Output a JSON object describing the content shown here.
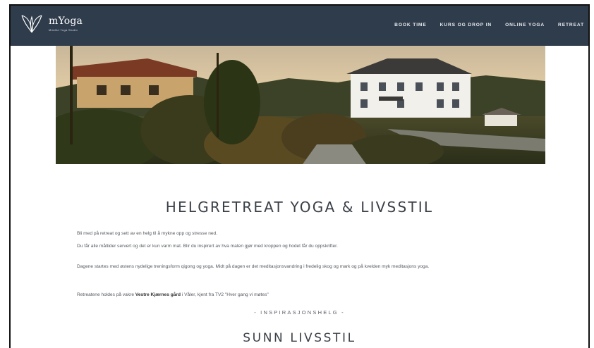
{
  "header": {
    "logo_name": "mYoga",
    "logo_tagline": "Mindful Yoga Studio",
    "nav": [
      {
        "label": "BOOK TIME"
      },
      {
        "label": "KURS OG DROP IN"
      },
      {
        "label": "ONLINE YOGA"
      },
      {
        "label": "RETREAT"
      }
    ]
  },
  "hero": {
    "icon": "farmhouse-photo"
  },
  "content": {
    "title": "HELGRETREAT YOGA & LIVSSTIL",
    "paragraphs": [
      "Bli med på retreat og sett av en helg til å mykne opp og stresse ned.",
      "Du får alle måltider servert og det er kun varm mat. Blir du inspirert av hva maten gjør med kroppen og hodet får du oppskrifter.",
      "Dagene startes med østens nydelige treningsform qigong og yoga. Midt på dagen er det meditasjonsvandring i fredelig skog og mark og på kvelden myk meditasjons yoga."
    ],
    "venue": {
      "prefix": "Retreatene holdes på vakre ",
      "name": "Vestre Kjærnes gård",
      "suffix": " i Våler, kjent fra TV2 \"Hver gang vi møtes\""
    },
    "subheading": "- INSPIRASJONSHELG -",
    "second_title": "SUNN LIVSSTIL"
  },
  "colors": {
    "navbar_bg": "#2f3c4c",
    "text": "#555a60",
    "heading": "#3a3f47"
  }
}
